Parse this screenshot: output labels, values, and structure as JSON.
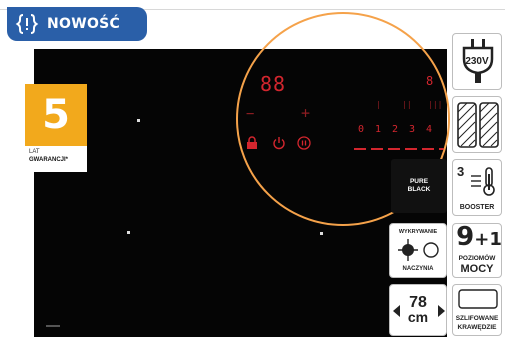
{
  "badge": {
    "label": "NOWOŚĆ",
    "icon": "braces-alert-icon",
    "color": "#2a5fa8"
  },
  "warranty": {
    "number": "5",
    "line1": "LAT",
    "line2": "GWARANCJI*",
    "color": "#f2a91c"
  },
  "hob": {
    "display_left": "88",
    "display_right": "8",
    "minus": "−",
    "plus": "+",
    "power_levels": [
      "0",
      "1",
      "2",
      "3",
      "4"
    ],
    "accent": "#d3262e",
    "magnifier_color": "#f5a24a"
  },
  "features": {
    "voltage": {
      "value": "230V",
      "icon": "plug-icon"
    },
    "glass": {
      "icon": "glass-panels-icon"
    },
    "booster": {
      "value": "3",
      "label": "BOOSTER",
      "icon": "thermometer-icon"
    },
    "pure_black": {
      "line1": "PURE",
      "line2": "BLACK"
    },
    "detection": {
      "line1": "WYKRYWANIE",
      "line2": "NACZYNIA",
      "icon": "pot-detection-icon"
    },
    "power": {
      "value_main": "9",
      "value_plus": "+1",
      "line1": "POZIOMÓW",
      "line2": "MOCY"
    },
    "width": {
      "value": "78",
      "unit": "cm",
      "icon": "width-arrows-icon"
    },
    "edges": {
      "line1": "SZLIFOWANE",
      "line2": "KRAWĘDZIE",
      "icon": "ground-edges-icon"
    }
  }
}
